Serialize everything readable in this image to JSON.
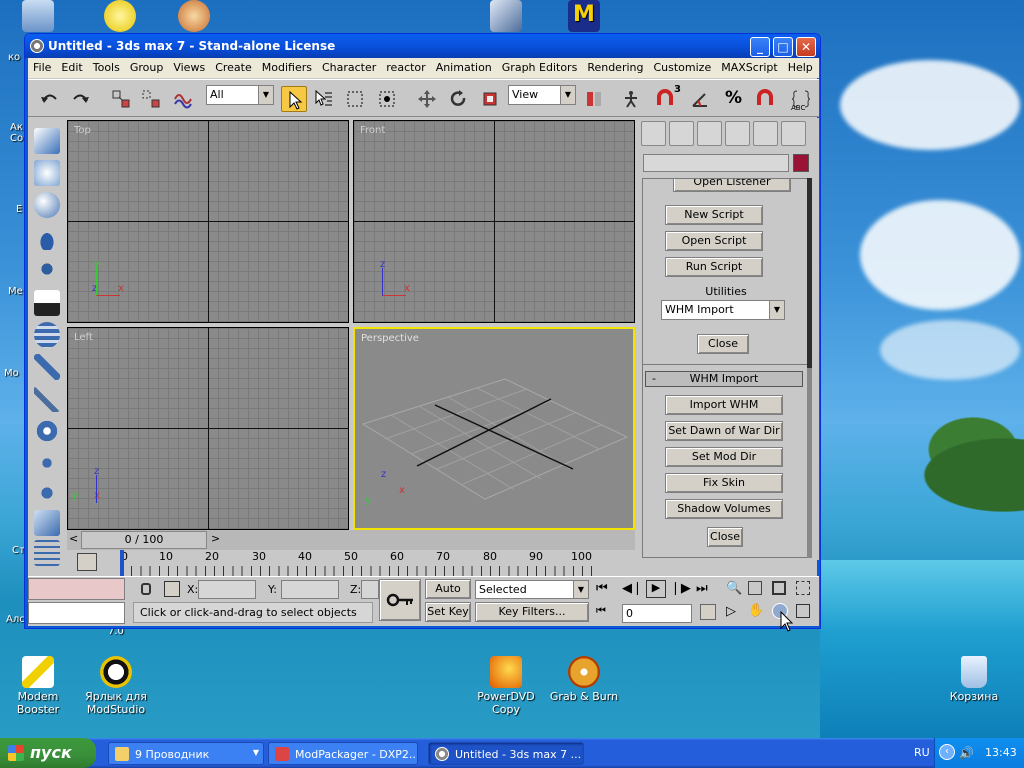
{
  "desktop": {
    "icons_left": [
      "ко",
      "Ак\nСо",
      "Е",
      "Ме",
      "Мо",
      "Ст",
      "Алс"
    ],
    "bottom_icons": [
      {
        "label": "Modem Booster"
      },
      {
        "label": "Ярлык для ModStudio"
      },
      {
        "label": "PowerDVD Copy"
      },
      {
        "label": "Grab & Burn"
      },
      {
        "label": "Корзина"
      }
    ],
    "version_text": "7.0"
  },
  "window": {
    "title": "Untitled - 3ds max 7  - Stand-alone License",
    "menu": [
      "File",
      "Edit",
      "Tools",
      "Group",
      "Views",
      "Create",
      "Modifiers",
      "Character",
      "reactor",
      "Animation",
      "Graph Editors",
      "Rendering",
      "Customize",
      "MAXScript",
      "Help"
    ],
    "selection_filter": "All",
    "ref_coord": "View",
    "snap_labels": [
      "3",
      "%"
    ],
    "abc": "ABC"
  },
  "viewports": {
    "top": "Top",
    "front": "Front",
    "left": "Left",
    "perspective": "Perspective",
    "axis": {
      "x": "x",
      "y": "y",
      "z": "z"
    }
  },
  "panel": {
    "listener_btn": "Open Listener",
    "new_script": "New Script",
    "open_script": "Open Script",
    "run_script": "Run Script",
    "utilities_label": "Utilities",
    "utilities_value": "WHM Import",
    "close1": "Close",
    "whm_header": "WHM Import",
    "whm_toggle": "-",
    "import_whm": "Import WHM",
    "set_dow": "Set Dawn of War Dir",
    "set_mod": "Set Mod Dir",
    "fix_skin": "Fix Skin",
    "shadow_volumes": "Shadow Volumes",
    "close2": "Close"
  },
  "timeline": {
    "slider": "0 / 100",
    "ticks": [
      0,
      10,
      20,
      30,
      40,
      50,
      60,
      70,
      80,
      90,
      100
    ]
  },
  "status": {
    "x_label": "X:",
    "y_label": "Y:",
    "z_label": "Z:",
    "auto_key": "Auto Key",
    "set_key": "Set Key",
    "selected": "Selected",
    "key_filters": "Key Filters...",
    "frame": "0",
    "prompt": "Click or click-and-drag to select objects"
  },
  "taskbar": {
    "start": "пуск",
    "items": [
      {
        "label": "9 Проводник"
      },
      {
        "label": "ModPackager - DXP2..."
      },
      {
        "label": "Untitled - 3ds max 7 ..."
      }
    ],
    "lang": "RU",
    "time": "13:43"
  },
  "colors": {
    "title_bar": "#0a5ff0",
    "viewport_active": "#f2e400",
    "object_color": "#9a1337",
    "taskbar": "#245edb",
    "start_button": "#3a8f3a"
  }
}
